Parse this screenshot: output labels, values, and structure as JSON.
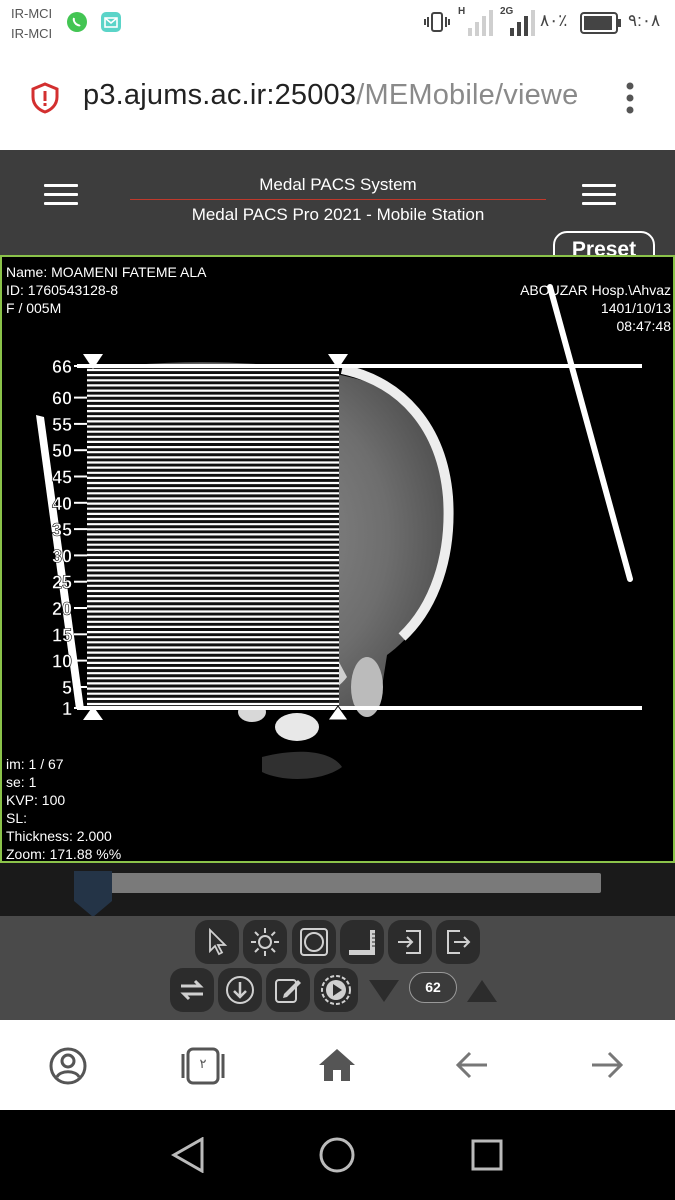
{
  "status_bar": {
    "carrier_1": "IR-MCI",
    "carrier_2": "IR-MCI",
    "network_h": "H",
    "network_2g": "2G",
    "battery_percent": "۸۰٪",
    "time": "۹:۰۸",
    "icons": [
      "whatsapp-icon",
      "message-icon",
      "vibrate-icon",
      "signal-icon",
      "battery-icon"
    ]
  },
  "browser": {
    "url_host": "p3.ajums.ac.ir:25003",
    "url_path": "/MEMobile/viewe",
    "icons": [
      "shield-alert-icon",
      "more-vert-icon"
    ]
  },
  "header": {
    "title": "Medal PACS System",
    "subtitle": "Medal PACS Pro 2021 - Mobile Station",
    "preset_label": "Preset",
    "accent_color": "#c0392b"
  },
  "viewer": {
    "patient_name": "Name: MOAMENI FATEME ALA",
    "patient_id": "ID: 1760543128-8",
    "sex_age": "F / 005M",
    "hospital": "ABOUZAR Hosp.\\Ahvaz",
    "date": "1401/10/13",
    "time": "08:47:48",
    "image_index": "im: 1 / 67",
    "series": "se: 1",
    "kvp": "KVP: 100",
    "slice_location": "SL:",
    "thickness": "Thickness: 2.000",
    "zoom": "Zoom: 171.88 %%",
    "scale_labels": [
      "66",
      "60",
      "55",
      "50",
      "45",
      "40",
      "35",
      "30",
      "25",
      "20",
      "15",
      "10",
      "5",
      "1"
    ],
    "border_color": "#8bc34a"
  },
  "slider": {
    "position_fraction": 0.0
  },
  "toolbar": {
    "row1_icons": [
      "pointer-icon",
      "brightness-icon",
      "fit-icon",
      "ruler-icon",
      "import-icon",
      "export-icon"
    ],
    "row2_icons": [
      "sync-icon",
      "download-icon",
      "edit-icon",
      "play-icon"
    ],
    "counter": "62"
  },
  "bottom_nav": {
    "tab_count": "۲",
    "icons": [
      "account-icon",
      "tabs-icon",
      "home-icon",
      "back-arrow-icon",
      "forward-arrow-icon"
    ]
  },
  "system_nav": {
    "icons": [
      "back-triangle-icon",
      "home-circle-icon",
      "recents-square-icon"
    ]
  }
}
